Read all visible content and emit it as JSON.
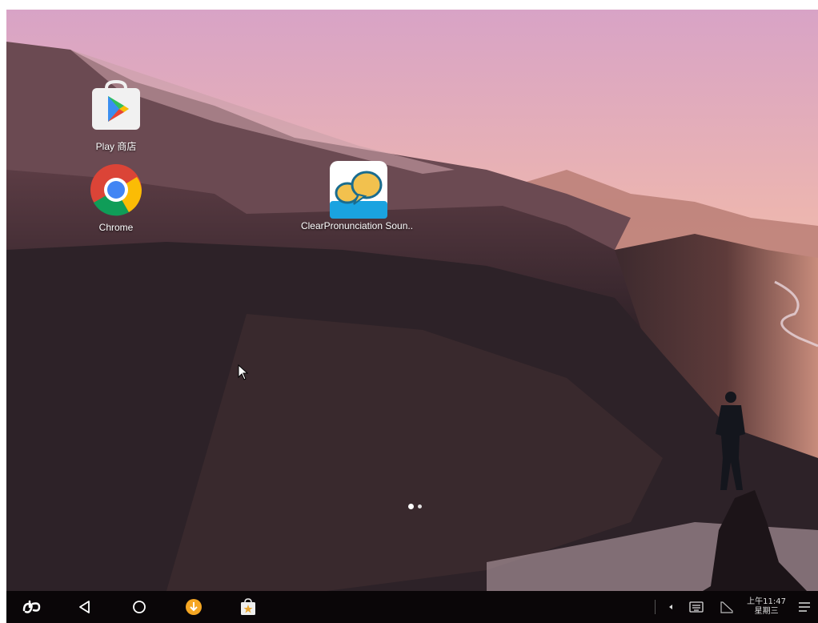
{
  "desktop": {
    "apps": [
      {
        "label": "Play 商店",
        "icon": "play-store-icon"
      },
      {
        "label": "Chrome",
        "icon": "chrome-icon"
      },
      {
        "label": "ClearPronunciation Soun..",
        "icon": "speech-bubbles-icon"
      }
    ],
    "page_indicator": {
      "pages": 2,
      "current": 1
    }
  },
  "taskbar": {
    "start_icon": "phoenix-logo-icon",
    "nav": [
      "back-icon",
      "home-icon",
      "download-icon",
      "store-bag-icon"
    ],
    "tray": [
      "arrow-left-icon",
      "keyboard-icon",
      "signal-icon",
      "menu-icon"
    ],
    "clock_time": "上午11:47",
    "clock_day": "星期三"
  },
  "colors": {
    "taskbar_bg": "#0a0608",
    "download_accent": "#f5a623"
  }
}
